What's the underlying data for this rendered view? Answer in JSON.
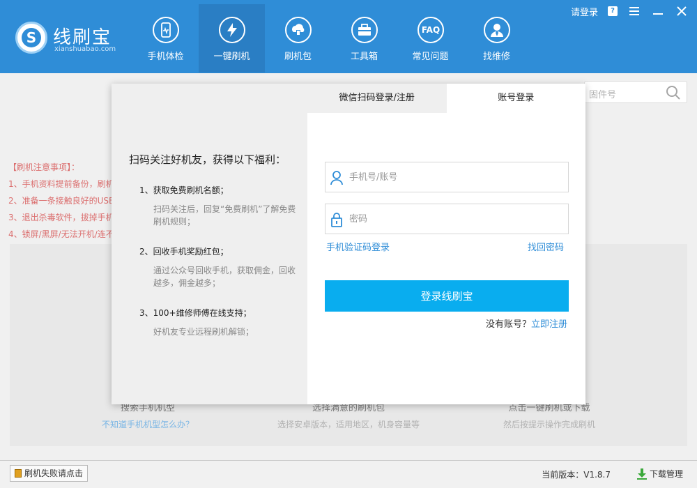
{
  "header": {
    "logo_name": "线刷宝",
    "logo_sub": "xianshuabao.com",
    "nav": [
      {
        "label": "手机体检",
        "icon": "phone-check-icon"
      },
      {
        "label": "一键刷机",
        "icon": "lightning-icon"
      },
      {
        "label": "刷机包",
        "icon": "package-icon"
      },
      {
        "label": "工具箱",
        "icon": "toolbox-icon"
      },
      {
        "label": "常见问题",
        "icon": "faq-icon"
      },
      {
        "label": "找维修",
        "icon": "technician-icon"
      }
    ],
    "faq_icon_text": "FAQ",
    "login_link": "请登录",
    "help_badge": "?"
  },
  "background": {
    "search_placeholder": "固件号",
    "notice": [
      "【刷机注意事项】：",
      "1、手机资料提前备份，刷机",
      "2、准备一条接触良好的USB",
      "3、退出杀毒软件，拔掉手机",
      "4、锁屏/黑屏/无法开机/连不"
    ],
    "steps": [
      {
        "title": "搜索手机机型",
        "sub": "不知道手机机型怎么办？"
      },
      {
        "title": "选择满意的刷机包",
        "sub": "选择安卓版本，适用地区，机身容量等"
      },
      {
        "title": "点击一键刷机或下载",
        "sub": "然后按提示操作完成刷机"
      }
    ]
  },
  "footer": {
    "fail_button": "刷机失败请点击",
    "version": "当前版本：V1.8.7",
    "download": "下载管理"
  },
  "modal": {
    "benefits_title": "扫码关注好机友，获得以下福利：",
    "benefits": [
      {
        "title": "1、获取免费刷机名额；",
        "desc": "扫码关注后，回复“免费刷机”了解免费刷机规则；"
      },
      {
        "title": "2、回收手机奖励红包；",
        "desc": "通过公众号回收手机，获取佣金，回收越多，佣金越多；"
      },
      {
        "title": "3、100+维修师傅在线支持；",
        "desc": "好机友专业远程刷机解锁；"
      }
    ],
    "tabs": [
      {
        "label": "微信扫码登录/注册"
      },
      {
        "label": "账号登录"
      }
    ],
    "account_placeholder": "手机号/账号",
    "password_placeholder": "密码",
    "sms_login": "手机验证码登录",
    "forgot_password": "找回密码",
    "login_button": "登录线刷宝",
    "no_account": "没有账号？",
    "register_now": "立即注册"
  },
  "colors": {
    "header_bg": "#2f8dd7",
    "accent": "#09adef",
    "link": "#2f8dd7",
    "notice_red": "#c82121"
  }
}
